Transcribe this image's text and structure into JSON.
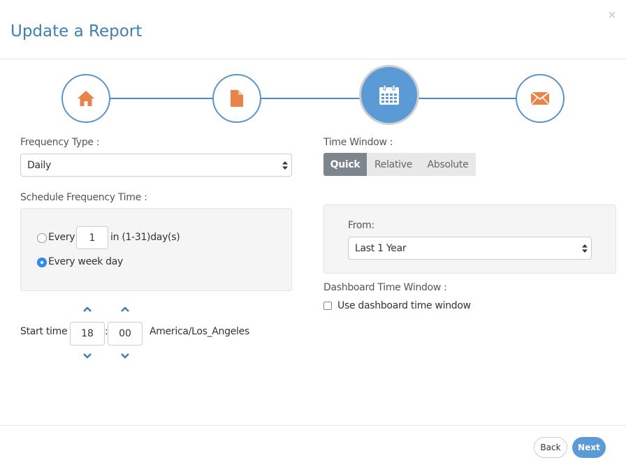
{
  "dialog": {
    "title": "Update a Report",
    "close_glyph": "×"
  },
  "stepper": {
    "steps": [
      {
        "icon": "home-icon",
        "active": false
      },
      {
        "icon": "file-icon",
        "active": false
      },
      {
        "icon": "calendar-icon",
        "active": true
      },
      {
        "icon": "envelope-icon",
        "active": false
      }
    ],
    "colors": {
      "accent": "#5b9bd5",
      "icon_orange": "#e8834a",
      "line": "#4b88c0"
    }
  },
  "left": {
    "frequency_type_label": "Frequency Type :",
    "frequency_type_value": "Daily",
    "schedule_label": "Schedule Frequency Time :",
    "every_label": "Every",
    "every_value": "1",
    "every_suffix": "in (1-31)day(s)",
    "week_day_label": "Every week day",
    "selected_option": "Every week day",
    "start_time_label": "Start time",
    "hour": "18",
    "colon": ":",
    "minute": "00",
    "timezone": "America/Los_Angeles"
  },
  "right": {
    "time_window_label": "Time Window :",
    "tabs": [
      "Quick",
      "Relative",
      "Absolute"
    ],
    "active_tab": "Quick",
    "from_label": "From:",
    "from_value": "Last 1 Year",
    "dashboard_label": "Dashboard Time Window :",
    "dashboard_checkbox_label": "Use dashboard time window",
    "dashboard_checked": false
  },
  "footer": {
    "back_label": "Back",
    "next_label": "Next"
  }
}
